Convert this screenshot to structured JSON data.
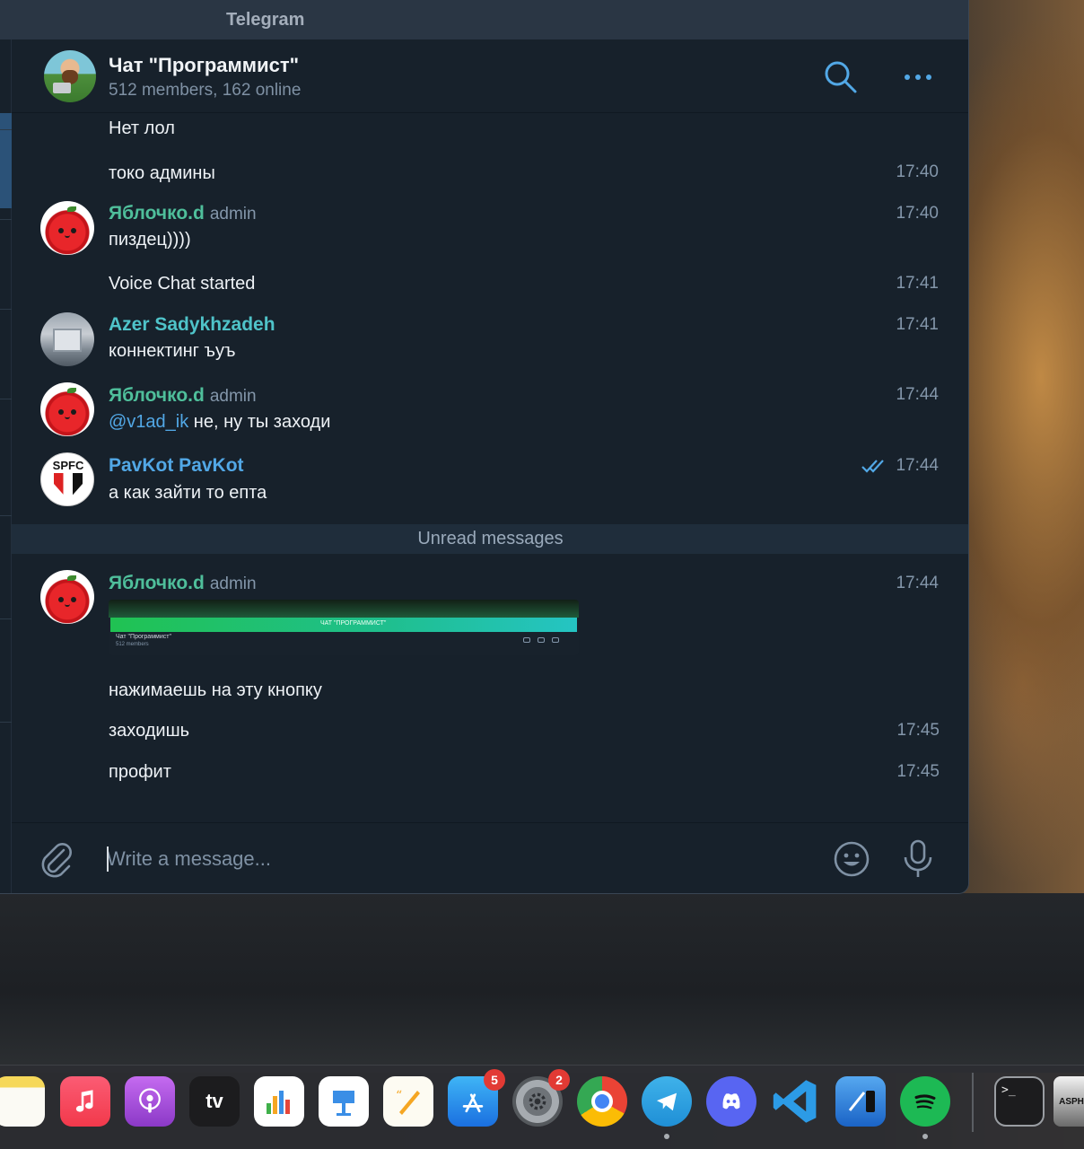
{
  "window": {
    "title": "Telegram"
  },
  "chat": {
    "title": "Чат \"Программист\"",
    "subtitle": "512 members, 162 online"
  },
  "messages": [
    {
      "text": "Нет лол"
    },
    {
      "text": "токо админы",
      "time": "17:40"
    },
    {
      "sender": "Яблочко.d",
      "role": "admin",
      "time": "17:40",
      "text": "пиздец))))"
    },
    {
      "text": "Voice Chat started",
      "time": "17:41"
    },
    {
      "sender": "Azer Sadykhzadeh",
      "time": "17:41",
      "text": "коннектинг ъуъ"
    },
    {
      "sender": "Яблочко.d",
      "role": "admin",
      "time": "17:44",
      "mention": "@v1ad_ik",
      "text": " не, ну ты заходи"
    },
    {
      "sender": "PavKot PavKot",
      "time": "17:44",
      "text": "а как зайти то епта"
    }
  ],
  "unread_label": "Unread messages",
  "unread_messages": [
    {
      "sender": "Яблочко.d",
      "role": "admin",
      "time": "17:44",
      "screenshot": {
        "title": "ЧАТ \"ПРОГРАММИСТ\"",
        "line1": "Чат \"Программист\"",
        "line2": "512 members"
      }
    },
    {
      "text": "нажимаешь на эту кнопку"
    },
    {
      "text": "заходишь",
      "time": "17:45"
    },
    {
      "text": "профит",
      "time": "17:45"
    }
  ],
  "composer": {
    "placeholder": "Write a message..."
  },
  "avatar_texts": {
    "spfc": "SPFC"
  },
  "dock": {
    "apps": [
      {
        "name": "notes-icon"
      },
      {
        "name": "music-icon"
      },
      {
        "name": "podcasts-icon"
      },
      {
        "name": "apple-tv-icon",
        "label": "tv"
      },
      {
        "name": "numbers-icon"
      },
      {
        "name": "keynote-icon"
      },
      {
        "name": "pages-icon"
      },
      {
        "name": "app-store-icon",
        "badge": "5"
      },
      {
        "name": "system-preferences-icon",
        "badge": "2"
      },
      {
        "name": "chrome-icon"
      },
      {
        "name": "telegram-icon"
      },
      {
        "name": "discord-icon"
      },
      {
        "name": "vscode-icon"
      },
      {
        "name": "xcode-icon"
      },
      {
        "name": "spotify-icon"
      },
      {
        "name": "terminal-icon",
        "label": ">_"
      },
      {
        "name": "asphalt-game-icon",
        "label": "ASPH"
      }
    ]
  },
  "colors": {
    "window_bg": "#17212b",
    "accent_blue": "#52a8e6",
    "sender_green": "#4fbf9b",
    "badge_red": "#e23a34"
  }
}
